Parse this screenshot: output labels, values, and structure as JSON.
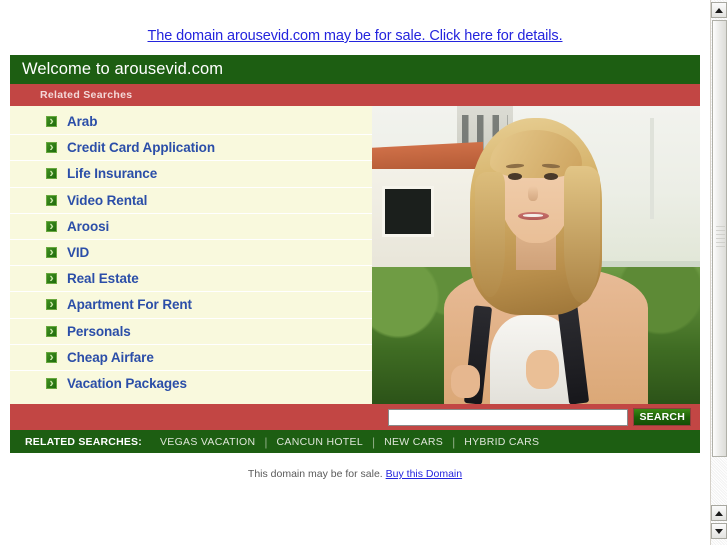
{
  "top_notice": {
    "link_text": "The domain arousevid.com may be for sale. Click here for details."
  },
  "header": {
    "welcome_title": "Welcome to arousevid.com",
    "related_searches_label": "Related Searches"
  },
  "related_links": [
    {
      "label": "Arab"
    },
    {
      "label": "Credit Card Application"
    },
    {
      "label": "Life Insurance"
    },
    {
      "label": "Video Rental"
    },
    {
      "label": "Aroosi"
    },
    {
      "label": "VID"
    },
    {
      "label": "Real Estate"
    },
    {
      "label": "Apartment For Rent"
    },
    {
      "label": "Personals"
    },
    {
      "label": "Cheap Airfare"
    },
    {
      "label": "Vacation Packages"
    }
  ],
  "photo": {
    "alt": "smiling blonde woman with backpack outdoors"
  },
  "search": {
    "value": "",
    "placeholder": "",
    "button_label": "SEARCH"
  },
  "footer": {
    "label": "RELATED SEARCHES:",
    "links": [
      {
        "label": "VEGAS VACATION"
      },
      {
        "label": "CANCUN HOTEL"
      },
      {
        "label": "NEW CARS"
      },
      {
        "label": "HYBRID CARS"
      }
    ],
    "separator": "|"
  },
  "bottom_note": {
    "text": "This domain may be for sale. ",
    "link_text": "Buy this Domain"
  },
  "colors": {
    "green_header": "#1d5e12",
    "red_bar": "#c24644",
    "list_background": "#f9f9dd",
    "link_blue": "#2b4ea8",
    "notice_blue": "#2424dd"
  },
  "scrollbar": {
    "up_arrow": "triangle-up",
    "down_arrow": "triangle-down"
  }
}
